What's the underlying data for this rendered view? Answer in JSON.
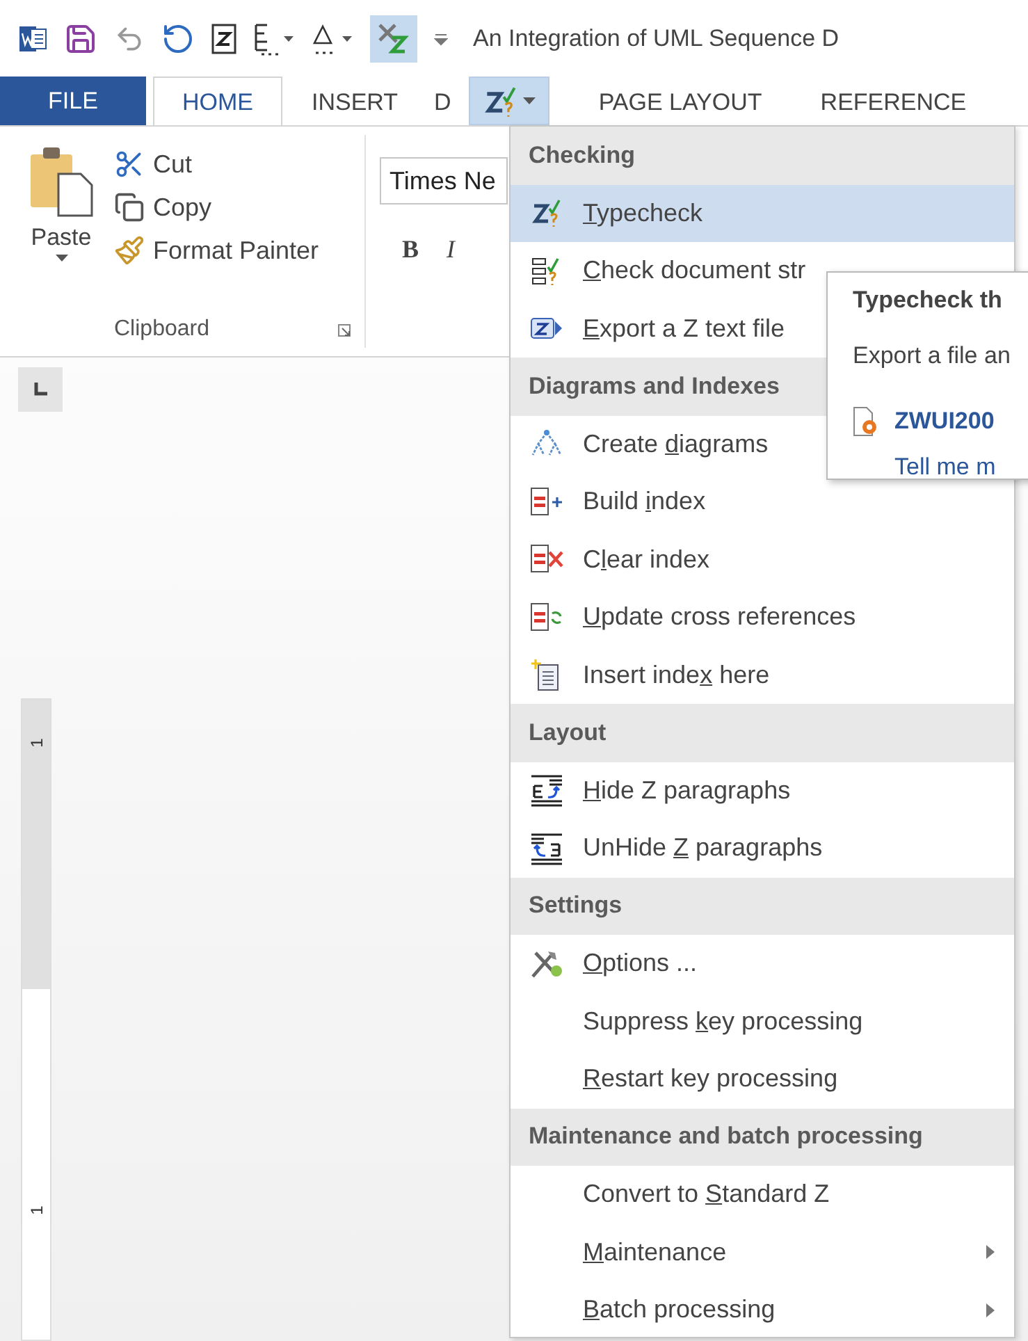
{
  "quick_access": {
    "document_title": "An Integration of UML Sequence D"
  },
  "ribbon_tabs": [
    {
      "kind": "file",
      "label": "FILE",
      "selected": false
    },
    {
      "kind": "tab",
      "label": "HOME",
      "selected": true
    },
    {
      "kind": "tab",
      "label": "INSERT",
      "selected": false
    },
    {
      "kind": "tab",
      "label": "D",
      "selected": false
    },
    {
      "kind": "menu",
      "open": true
    },
    {
      "kind": "tab",
      "label": "PAGE LAYOUT",
      "selected": false
    },
    {
      "kind": "tab",
      "label": "REFERENCE",
      "selected": false
    }
  ],
  "clipboard": {
    "paste": "Paste",
    "actions": [
      "Cut",
      "Copy",
      "Format Painter"
    ],
    "group_label": "Clipboard"
  },
  "font": {
    "value": "Times Ne",
    "buttons": [
      "B",
      "I"
    ]
  },
  "vertical_ruler": {
    "labels": [
      "1",
      "1"
    ]
  },
  "menu": [
    {
      "kind": "section",
      "label": "Checking"
    },
    {
      "kind": "item",
      "key": "T",
      "after": "ypecheck",
      "selected": true,
      "submenu": false
    },
    {
      "kind": "item",
      "key": "C",
      "after": "heck document str",
      "selected": false,
      "submenu": false
    },
    {
      "kind": "item",
      "key": "E",
      "after": "xport a Z text file",
      "selected": false,
      "submenu": false
    },
    {
      "kind": "section",
      "label": "Diagrams and Indexes"
    },
    {
      "kind": "item",
      "before": "Create ",
      "key": "d",
      "after": "iagrams",
      "selected": false,
      "submenu": false
    },
    {
      "kind": "item",
      "before": "Build ",
      "key": "i",
      "after": "ndex",
      "selected": false,
      "submenu": false
    },
    {
      "kind": "item",
      "before": "C",
      "key": "l",
      "after": "ear index",
      "selected": false,
      "submenu": false
    },
    {
      "kind": "item",
      "key": "U",
      "after": "pdate cross references",
      "selected": false,
      "submenu": false
    },
    {
      "kind": "item",
      "before": "Insert inde",
      "key": "x",
      "after": " here",
      "selected": false,
      "submenu": false
    },
    {
      "kind": "section",
      "label": "Layout"
    },
    {
      "kind": "item",
      "key": "H",
      "after": "ide Z paragraphs",
      "selected": false,
      "submenu": false
    },
    {
      "kind": "item",
      "before": "UnHide ",
      "key": "Z",
      "after": " paragraphs",
      "selected": false,
      "submenu": false
    },
    {
      "kind": "section",
      "label": "Settings"
    },
    {
      "kind": "item",
      "key": "O",
      "after": "ptions ...",
      "selected": false,
      "submenu": false
    },
    {
      "kind": "item",
      "before": "Suppress ",
      "key": "k",
      "after": "ey processing",
      "selected": false,
      "submenu": false
    },
    {
      "kind": "item",
      "key": "R",
      "after": "estart key processing",
      "selected": false,
      "submenu": false
    },
    {
      "kind": "section",
      "label": "Maintenance and batch processing"
    },
    {
      "kind": "item",
      "before": "Convert to ",
      "key": "S",
      "after": "tandard Z",
      "selected": false,
      "submenu": false
    },
    {
      "kind": "item",
      "key": "M",
      "after": "aintenance",
      "selected": false,
      "submenu": true
    },
    {
      "kind": "item",
      "key": "B",
      "after": "atch processing",
      "selected": false,
      "submenu": true
    }
  ],
  "tooltip": {
    "title": "Typecheck th",
    "description": "Export a file an",
    "link": "ZWUI200",
    "more": "Tell me m"
  }
}
